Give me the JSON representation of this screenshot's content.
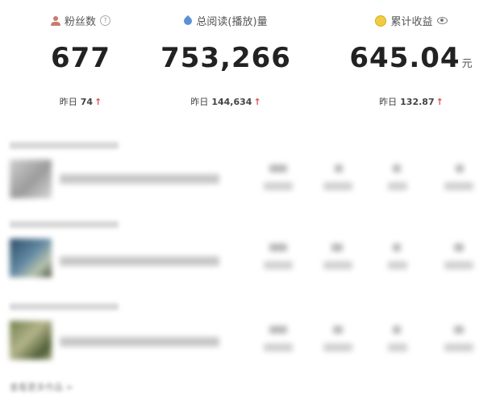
{
  "stats": [
    {
      "label": "粉丝数",
      "icon": "person-icon",
      "extra_icon": "help-icon",
      "help_glyph": "?",
      "value": "677",
      "unit": "",
      "yesterday_label": "昨日",
      "yesterday_value": "74",
      "trend": "↑"
    },
    {
      "label": "总阅读(播放)量",
      "icon": "drop-icon",
      "value": "753,266",
      "unit": "",
      "yesterday_label": "昨日",
      "yesterday_value": "144,634",
      "trend": "↑"
    },
    {
      "label": "累计收益",
      "icon": "coin-icon",
      "extra_icon": "eye-icon",
      "value": "645.04",
      "unit": "元",
      "yesterday_label": "昨日",
      "yesterday_value": "132.87",
      "trend": "↑"
    }
  ],
  "colors": {
    "trend_up": "#d9534f",
    "value_text": "#222222",
    "label_text": "#555555"
  },
  "works": {
    "more_link": "查看更多作品 >"
  }
}
